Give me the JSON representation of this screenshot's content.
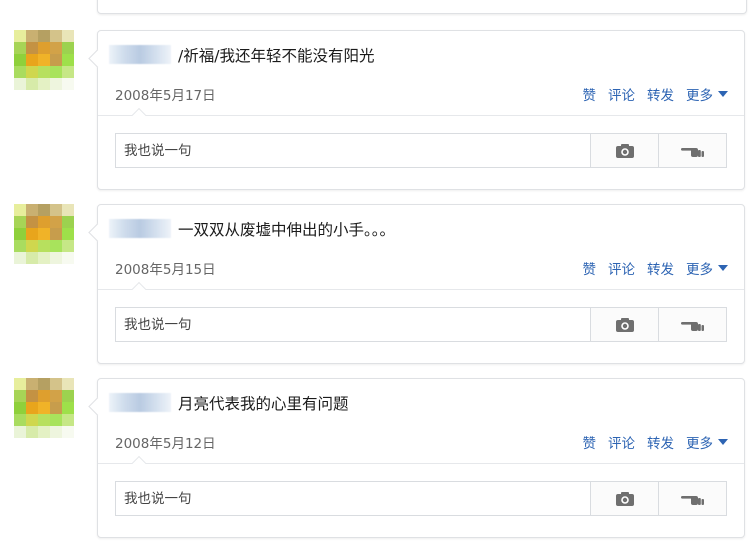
{
  "colors": {
    "link": "#2d64b3",
    "border": "#dfe1e4",
    "text": "#1b1b1b",
    "muted": "#666666"
  },
  "posts": [
    {
      "status": "/祈福/我还年轻不能没有阳光",
      "date": "2008年5月17日",
      "actions": {
        "like": "赞",
        "comment": "评论",
        "share": "转发",
        "more": "更多"
      },
      "comment_placeholder": "我也说一句",
      "icons": {
        "photo": "camera-icon",
        "poke": "pointing-hand-icon"
      }
    },
    {
      "status": "一双双从废墟中伸出的小手。。。",
      "date": "2008年5月15日",
      "actions": {
        "like": "赞",
        "comment": "评论",
        "share": "转发",
        "more": "更多"
      },
      "comment_placeholder": "我也说一句",
      "icons": {
        "photo": "camera-icon",
        "poke": "pointing-hand-icon"
      }
    },
    {
      "status": "月亮代表我的心里有问题",
      "date": "2008年5月12日",
      "actions": {
        "like": "赞",
        "comment": "评论",
        "share": "转发",
        "more": "更多"
      },
      "comment_placeholder": "我也说一句",
      "icons": {
        "photo": "camera-icon",
        "poke": "pointing-hand-icon"
      }
    }
  ]
}
